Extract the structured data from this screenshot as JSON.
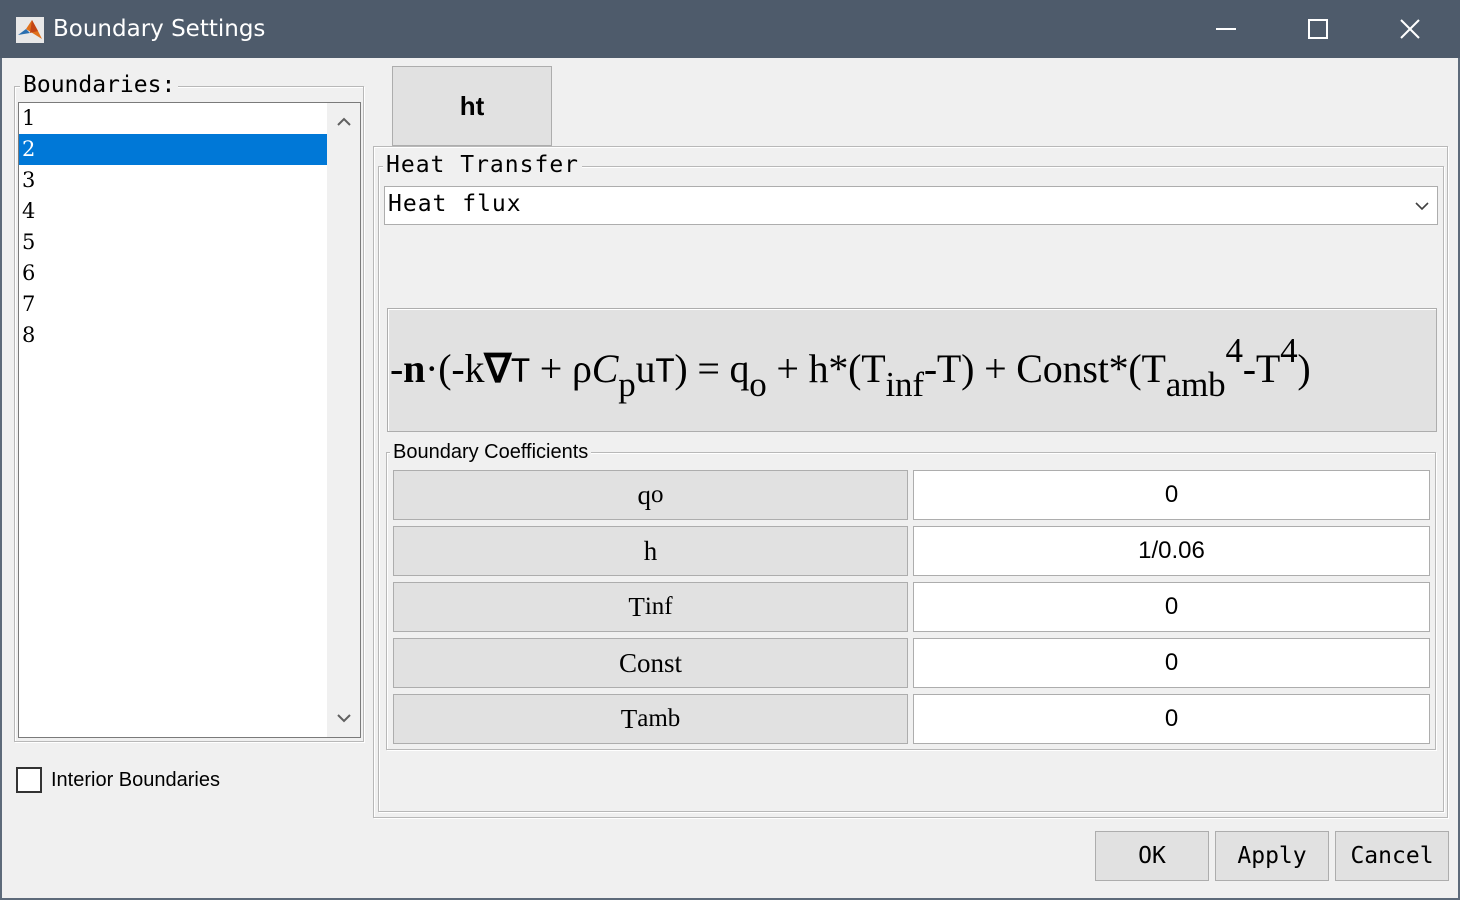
{
  "window": {
    "title": "Boundary Settings",
    "app_icon": "matlab-icon"
  },
  "boundaries": {
    "title": "Boundaries:",
    "items": [
      "1",
      "2",
      "3",
      "4",
      "5",
      "6",
      "7",
      "8"
    ],
    "selected": "2"
  },
  "interior_boundaries": {
    "label": "Interior Boundaries",
    "checked": false
  },
  "tab": {
    "label": "ht"
  },
  "heat_transfer": {
    "title": "Heat Transfer",
    "selected_value": "Heat flux"
  },
  "equation": {
    "p1": "-",
    "n": "n",
    "p2": "·(-k",
    "nabla": "∇",
    "T1": "T",
    "p3": " + ρ",
    "C": "C",
    "p_sub": "p",
    "u": "u",
    "T2": "T",
    "p4": ") = q",
    "o_sub": "o",
    "p5": " + h*(T",
    "inf_sub": "inf",
    "p6": "-T) + Const*(T",
    "amb_sub": "amb",
    "sup4a": "4",
    "p7": "-T",
    "sup4b": "4",
    "p8": ")"
  },
  "coefficients": {
    "title": "Boundary Coefficients",
    "rows": [
      {
        "label": "q",
        "sub": "o",
        "value": "0"
      },
      {
        "label": "h",
        "sub": "",
        "value": "1/0.06"
      },
      {
        "label": "T",
        "sub": "inf",
        "value": "0"
      },
      {
        "label": "Const",
        "sub": "",
        "value": "0"
      },
      {
        "label": "T",
        "sub": "amb",
        "value": "0"
      }
    ]
  },
  "buttons": {
    "ok": "OK",
    "apply": "Apply",
    "cancel": "Cancel"
  },
  "colors": {
    "titlebar": "#4e5b6b",
    "selection": "#0078d7",
    "window_bg": "#f0f0f0"
  }
}
